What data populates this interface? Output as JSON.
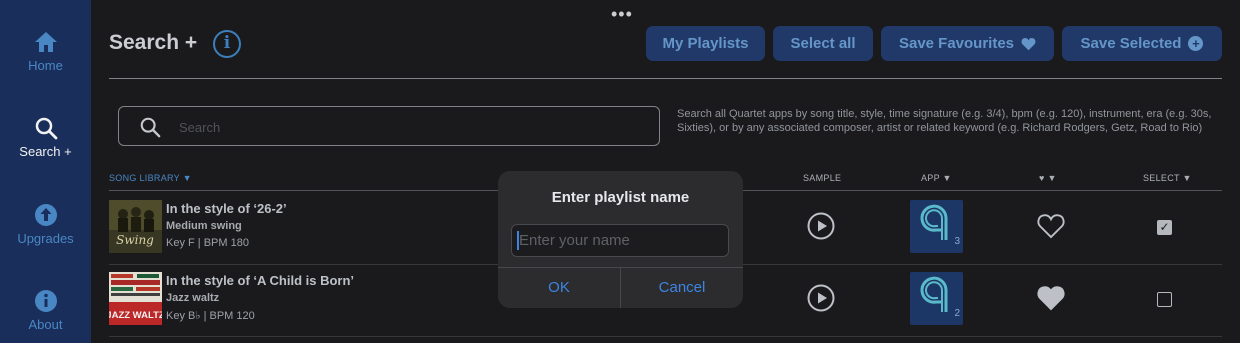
{
  "sidebar": {
    "items": [
      {
        "label": "Home",
        "icon": "home-icon",
        "active": false
      },
      {
        "label": "Search +",
        "icon": "search-icon",
        "active": true
      },
      {
        "label": "Upgrades",
        "icon": "arrow-up-circle-icon",
        "active": false
      },
      {
        "label": "About",
        "icon": "info-circle-icon",
        "active": false
      }
    ]
  },
  "header": {
    "title": "Search +",
    "more_dots": "•••",
    "info_glyph": "i",
    "buttons": {
      "my_playlists": "My Playlists",
      "select_all": "Select all",
      "save_favourites": "Save Favourites",
      "save_selected": "Save Selected"
    }
  },
  "search": {
    "placeholder": "Search",
    "help_text": "Search all Quartet apps by song title, style, time signature (e.g. 3/4), bpm (e.g. 120), instrument, era (e.g. 30s, Sixties), or by any associated composer, artist or related keyword (e.g. Richard Rodgers, Getz, Road to Rio)"
  },
  "columns": {
    "song_library": "SONG LIBRARY ▼",
    "sample": "SAMPLE",
    "app": "APP ▼",
    "favourite": "♥ ▼",
    "select": "SELECT ▼"
  },
  "songs": [
    {
      "title": "In the style of ‘26-2’",
      "style": "Medium swing",
      "meta": "Key F | BPM 180",
      "app_number": "3",
      "favourite": false,
      "selected": true
    },
    {
      "title": "In the style of ‘A Child is Born’",
      "style": "Jazz waltz",
      "meta": "Key B♭ | BPM 120",
      "app_number": "2",
      "favourite": true,
      "selected": false
    }
  ],
  "dialog": {
    "title": "Enter playlist name",
    "input_placeholder": "Enter your name",
    "ok_label": "OK",
    "cancel_label": "Cancel"
  },
  "thumbnails": {
    "row1_text": "Swing",
    "row2_text": "JAZZ WALTZ"
  },
  "colors": {
    "sidebar_bg": "#1b3160",
    "accent_blue": "#3d85e0",
    "button_bg": "#233d6e"
  }
}
